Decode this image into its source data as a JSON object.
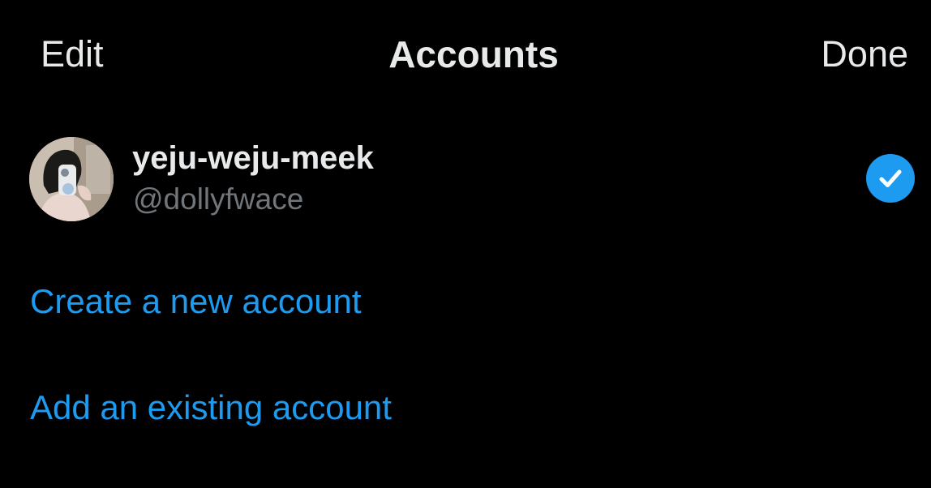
{
  "header": {
    "edit_label": "Edit",
    "title": "Accounts",
    "done_label": "Done"
  },
  "accounts": [
    {
      "display_name": "yeju-weju-meek",
      "handle": "@dollyfwace",
      "selected": true,
      "selected_icon": "checkmark-circle-icon",
      "avatar_icon": "profile-photo"
    }
  ],
  "actions": {
    "create_label": "Create a new account",
    "add_label": "Add an existing account"
  },
  "colors": {
    "background": "#000000",
    "primary_text": "#e7e9ea",
    "secondary_text": "#71767b",
    "accent": "#1d9bf0"
  }
}
